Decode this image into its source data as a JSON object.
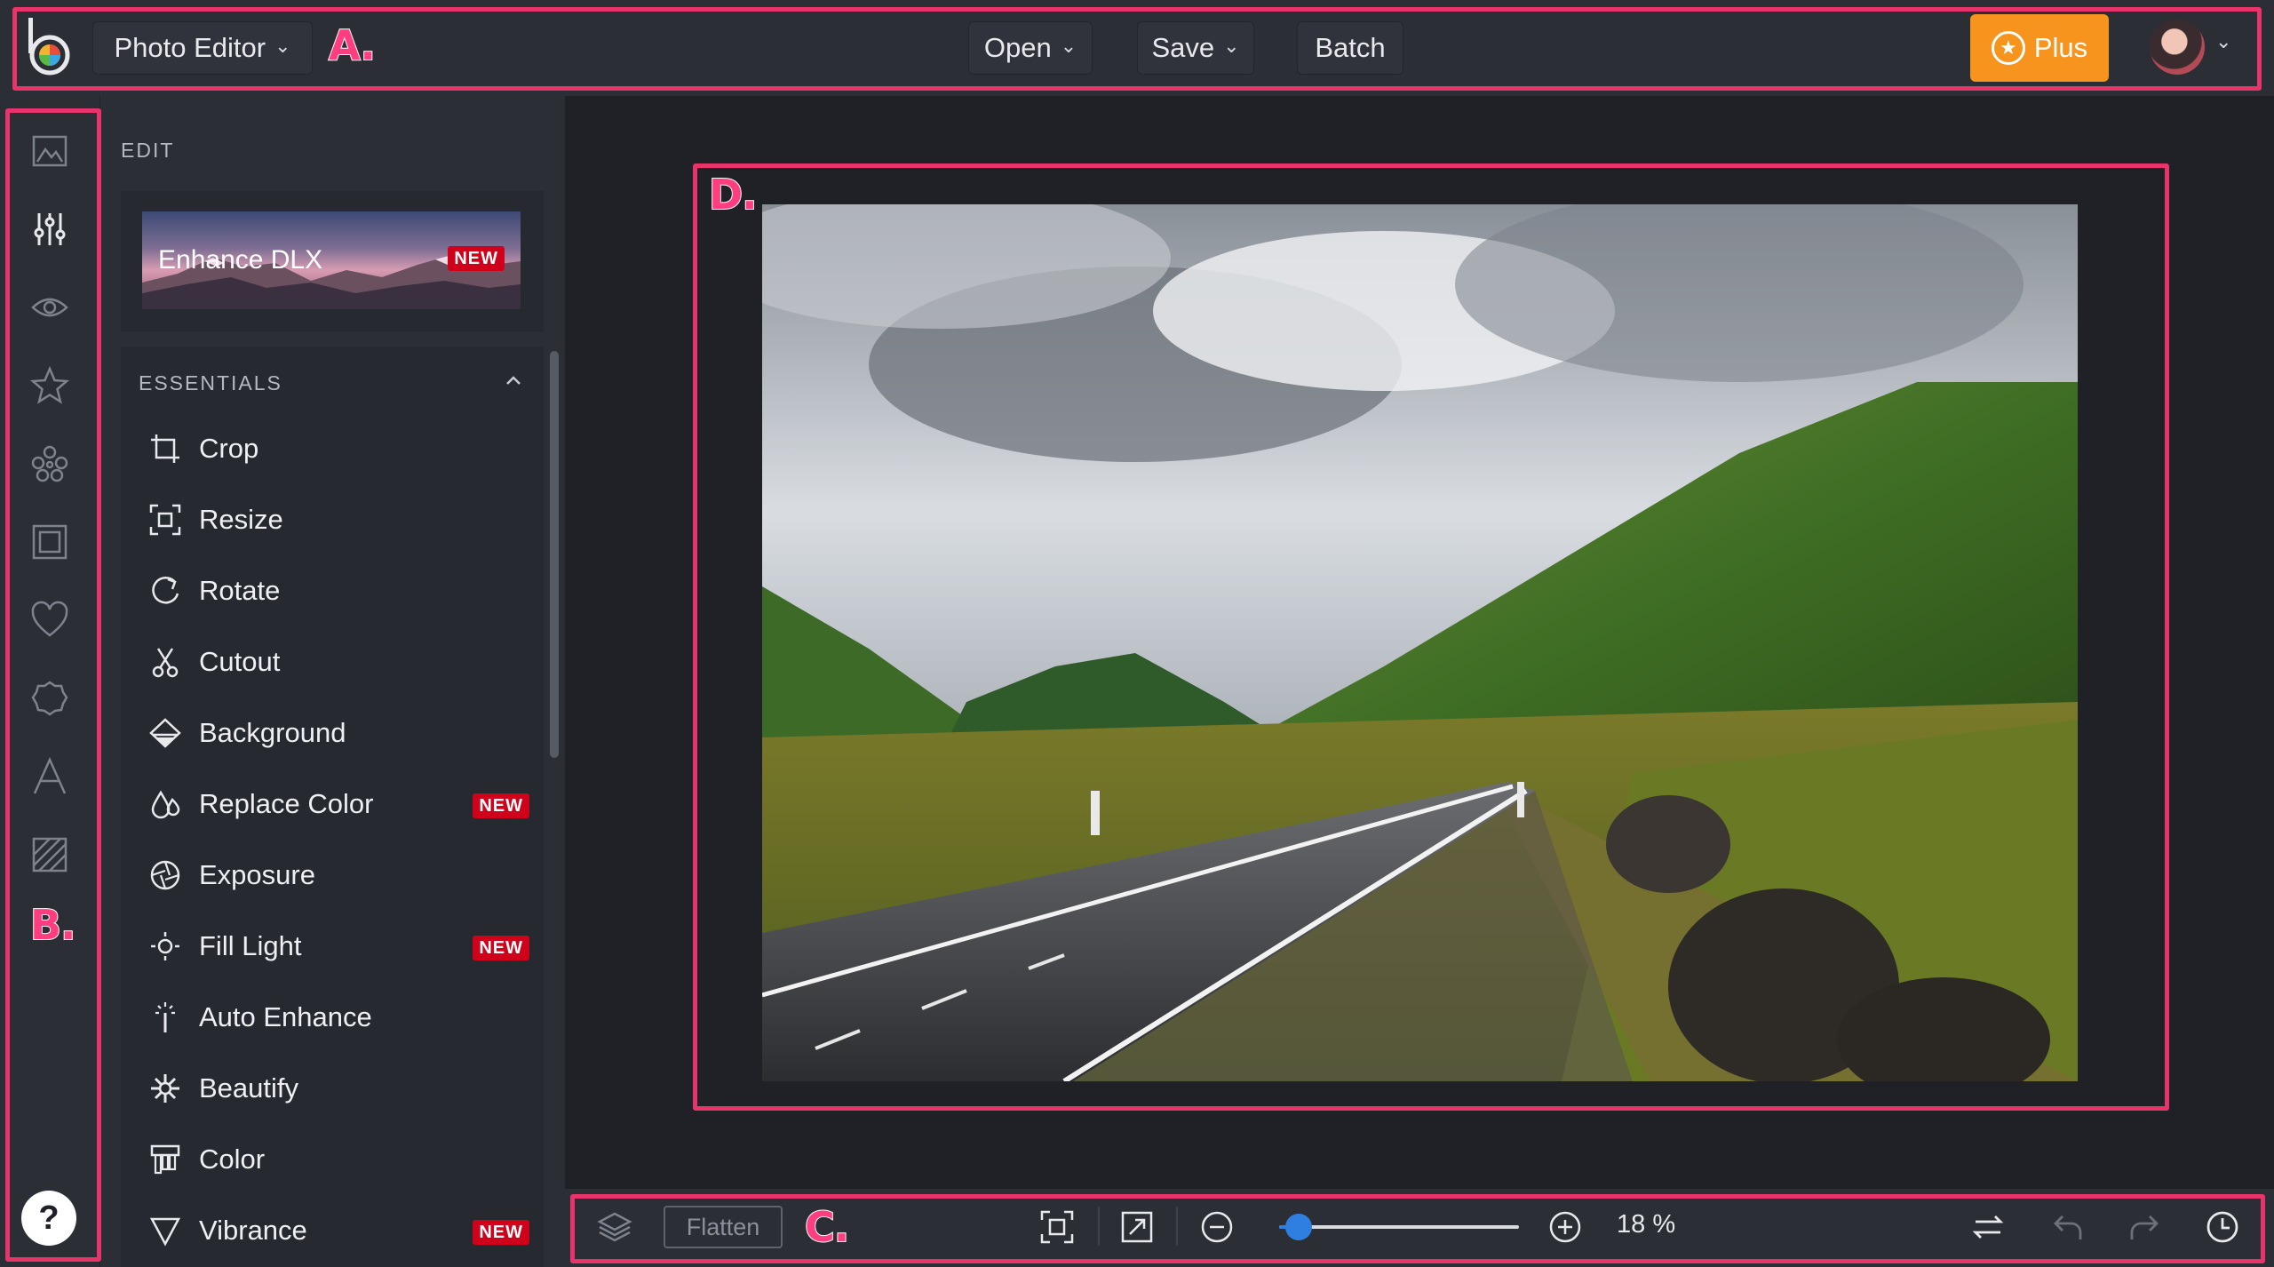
{
  "topbar": {
    "app_menu_label": "Photo Editor",
    "open_label": "Open",
    "save_label": "Save",
    "batch_label": "Batch",
    "plus_label": "Plus"
  },
  "panel": {
    "edit_title": "EDIT",
    "enhance_label": "Enhance DLX",
    "enhance_badge": "NEW",
    "essentials_title": "ESSENTIALS",
    "tools": [
      {
        "label": "Crop",
        "icon": "crop-icon",
        "badge": ""
      },
      {
        "label": "Resize",
        "icon": "resize-icon",
        "badge": ""
      },
      {
        "label": "Rotate",
        "icon": "rotate-icon",
        "badge": ""
      },
      {
        "label": "Cutout",
        "icon": "scissors-icon",
        "badge": ""
      },
      {
        "label": "Background",
        "icon": "background-icon",
        "badge": ""
      },
      {
        "label": "Replace Color",
        "icon": "drops-icon",
        "badge": "NEW"
      },
      {
        "label": "Exposure",
        "icon": "aperture-icon",
        "badge": ""
      },
      {
        "label": "Fill Light",
        "icon": "sun-icon",
        "badge": "NEW"
      },
      {
        "label": "Auto Enhance",
        "icon": "magic-wand-icon",
        "badge": ""
      },
      {
        "label": "Beautify",
        "icon": "sparkle-icon",
        "badge": ""
      },
      {
        "label": "Color",
        "icon": "color-swatch-icon",
        "badge": ""
      },
      {
        "label": "Vibrance",
        "icon": "triangle-icon",
        "badge": "NEW"
      }
    ]
  },
  "rail": {
    "help_label": "?",
    "icons": [
      "image-icon",
      "sliders-icon",
      "eye-icon",
      "star-icon",
      "flower-icon",
      "frame-icon",
      "heart-icon",
      "badge-icon",
      "text-icon",
      "texture-icon"
    ]
  },
  "bottombar": {
    "flatten_label": "Flatten",
    "zoom_label": "18 %",
    "zoom_level": 0.08
  },
  "callouts": {
    "a": "A.",
    "b": "B.",
    "c": "C.",
    "d": "D."
  },
  "colors": {
    "accent_plus": "#f7941d",
    "new_badge": "#d0021b",
    "callout_frame": "#e8336b",
    "slider_blue": "#2f7fe0"
  }
}
